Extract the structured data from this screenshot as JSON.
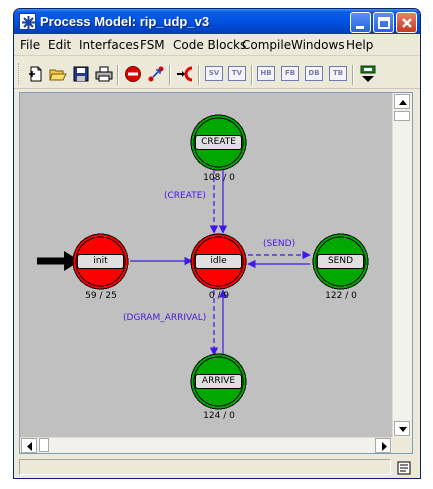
{
  "window": {
    "title": "Process Model: rip_udp_v3"
  },
  "menubar": {
    "items": [
      "File",
      "Edit",
      "Interfaces",
      "FSM",
      "Code Blocks",
      "Compile",
      "Windows",
      "Help"
    ]
  },
  "toolbar": {
    "icons": [
      "new-file-icon",
      "open-folder-icon",
      "save-disk-icon",
      "print-icon",
      "stop-icon",
      "transition-icon",
      "create-initial-state-icon"
    ],
    "text_buttons": [
      "SV",
      "TV",
      "HB",
      "FB",
      "DB",
      "TB"
    ],
    "compile_icon": "compile-down-arrow-icon"
  },
  "states": {
    "create": {
      "label": "CREATE",
      "stat": "108 / 0",
      "color": "#00a800"
    },
    "init": {
      "label": "init",
      "stat": "59 / 25",
      "color": "#ff0000"
    },
    "idle": {
      "label": "idle",
      "stat": "0 / 9",
      "color": "#ff0000"
    },
    "send": {
      "label": "SEND",
      "stat": "122 / 0",
      "color": "#00a800"
    },
    "arrive": {
      "label": "ARRIVE",
      "stat": "124 / 0",
      "color": "#00a800"
    }
  },
  "transitions": {
    "create": "(CREATE)",
    "send": "(SEND)",
    "arrive": "(DGRAM_ARRIVAL)"
  },
  "colors": {
    "transition": "#3f18e8",
    "canvas": "#c0c0c0",
    "titlebar": "#0054e3"
  }
}
